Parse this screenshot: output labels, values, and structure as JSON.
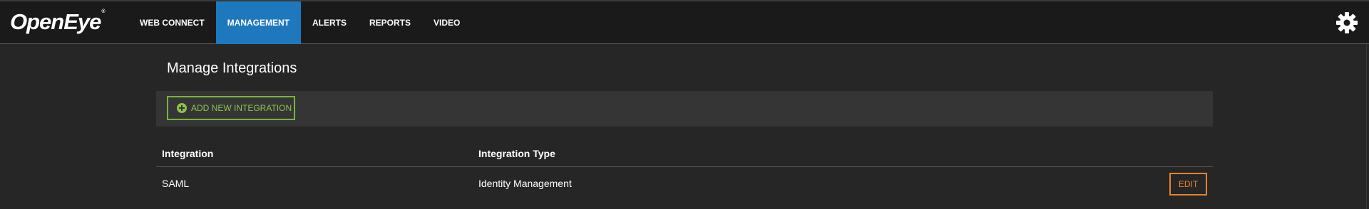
{
  "brand": {
    "name": "OpenEye",
    "tm": "®"
  },
  "nav": {
    "items": [
      {
        "label": "WEB CONNECT",
        "active": false
      },
      {
        "label": "MANAGEMENT",
        "active": true
      },
      {
        "label": "ALERTS",
        "active": false
      },
      {
        "label": "REPORTS",
        "active": false
      },
      {
        "label": "VIDEO",
        "active": false
      }
    ],
    "settings_icon": "gear-icon"
  },
  "page": {
    "title": "Manage Integrations"
  },
  "toolbar": {
    "add_label": "ADD NEW INTEGRATION",
    "add_icon": "plus-circle-icon"
  },
  "table": {
    "columns": [
      "Integration",
      "Integration Type"
    ],
    "rows": [
      {
        "integration": "SAML",
        "type": "Identity Management",
        "action": "EDIT"
      }
    ]
  },
  "colors": {
    "active_nav": "#1e78be",
    "add_button": "#8ac34a",
    "edit_button": "#e8822a",
    "background": "#262626",
    "topbar": "#1a1a1a"
  }
}
